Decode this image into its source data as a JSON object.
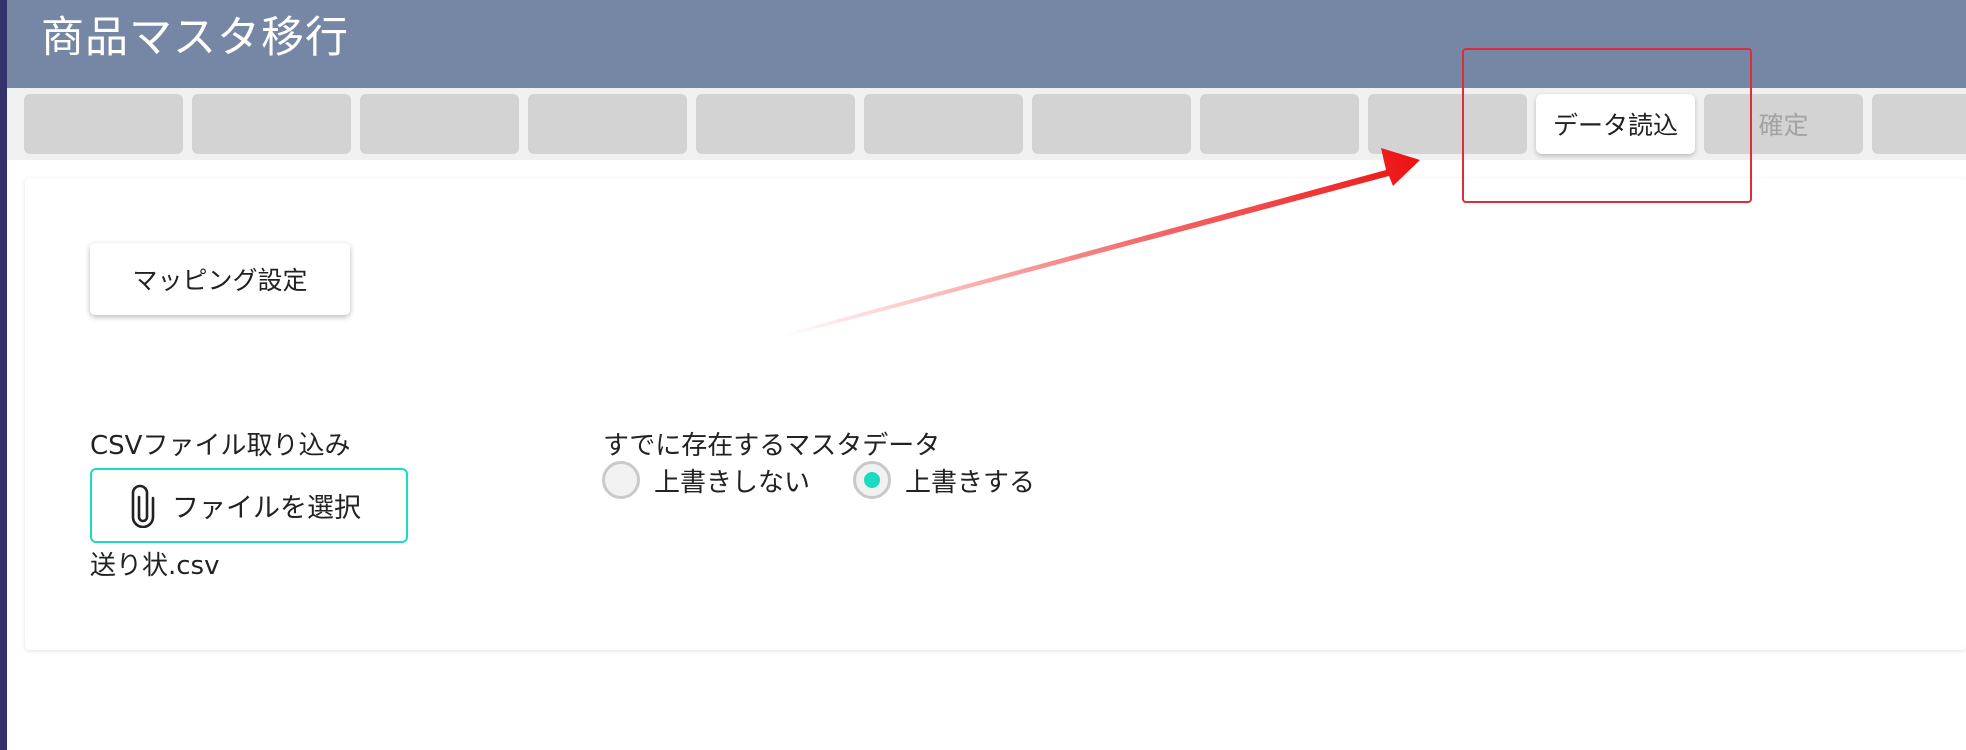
{
  "header": {
    "title": "商品マスタ移行"
  },
  "toolbar": {
    "buttons": [
      {
        "label": "",
        "state": "placeholder"
      },
      {
        "label": "",
        "state": "placeholder"
      },
      {
        "label": "",
        "state": "placeholder"
      },
      {
        "label": "",
        "state": "placeholder"
      },
      {
        "label": "",
        "state": "placeholder"
      },
      {
        "label": "",
        "state": "placeholder"
      },
      {
        "label": "",
        "state": "placeholder"
      },
      {
        "label": "",
        "state": "placeholder"
      },
      {
        "label": "",
        "state": "placeholder"
      },
      {
        "label": "データ読込",
        "state": "enabled"
      },
      {
        "label": "確定",
        "state": "disabled"
      },
      {
        "label": "",
        "state": "placeholder"
      }
    ]
  },
  "main": {
    "mapping_button": "マッピング設定",
    "csv_label": "CSVファイル取り込み",
    "file_button": "ファイルを選択",
    "file_name": "送り状.csv",
    "existing_label": "すでに存在するマスタデータ",
    "radio_options": [
      {
        "label": "上書きしない",
        "checked": false
      },
      {
        "label": "上書きする",
        "checked": true
      }
    ]
  },
  "colors": {
    "header": "#7687a5",
    "accent": "#19dcc0",
    "annotation": "#dd2d3a"
  },
  "icons": {
    "attach": "paperclip-icon"
  }
}
